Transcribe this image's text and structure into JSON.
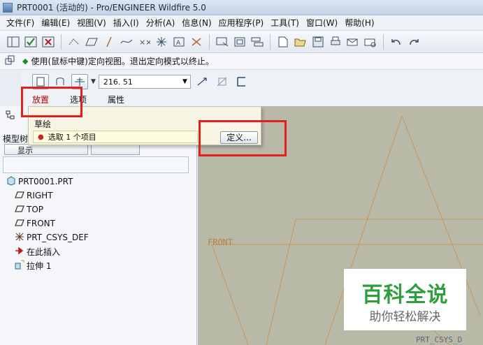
{
  "window": {
    "title": "PRT0001 (活动的) - Pro/ENGINEER Wildfire 5.0"
  },
  "menu": [
    "文件(F)",
    "编辑(E)",
    "视图(V)",
    "插入(I)",
    "分析(A)",
    "信息(N)",
    "应用程序(P)",
    "工具(T)",
    "窗口(W)",
    "帮助(H)"
  ],
  "message": "使用(鼠标中键)定向视图。退出定向模式以终止。",
  "dashboard": {
    "depth_value": "216. 51",
    "tabs": [
      "放置",
      "选项",
      "属性"
    ],
    "active_tab": "放置"
  },
  "placement_panel": {
    "sketch_label": "草绘",
    "select_text": "选取 1 个项目",
    "define_button": "定义..."
  },
  "left_panel": {
    "model_tree_label": "模型树",
    "show_button": "显示",
    "tree": [
      {
        "label": "PRT0001.PRT",
        "icon": "part-icon"
      },
      {
        "label": "RIGHT",
        "icon": "datum-plane-icon"
      },
      {
        "label": "TOP",
        "icon": "datum-plane-icon"
      },
      {
        "label": "FRONT",
        "icon": "datum-plane-icon"
      },
      {
        "label": "PRT_CSYS_DEF",
        "icon": "csys-icon"
      },
      {
        "label": "在此插入",
        "icon": "insert-here-arrow-icon"
      },
      {
        "label": "拉伸 1",
        "icon": "extrude-icon"
      }
    ]
  },
  "graphics": {
    "front_label": "FRONT",
    "csys_label": "PRT_CSYS_D"
  },
  "watermark": {
    "main": "百科全说",
    "sub": "助你轻松解决"
  },
  "colors": {
    "highlight": "#e0211d",
    "graphics_bg": "#b9b9a8",
    "datum": "#c99554",
    "watermark_green": "#2f9e3f"
  }
}
